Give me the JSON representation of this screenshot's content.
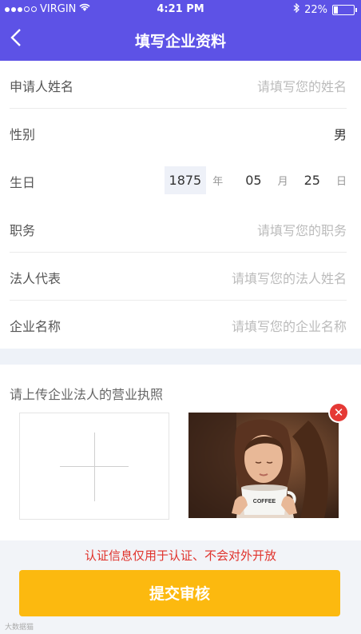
{
  "status_bar": {
    "carrier": "VIRGIN",
    "time": "4:21 PM",
    "battery": "22%",
    "battery_level": 0.22,
    "signal_icon": "signal-dots-icon",
    "wifi_icon": "wifi-icon",
    "bluetooth_icon": "bluetooth-icon"
  },
  "nav": {
    "back_icon": "back-arrow-icon",
    "title": "填写企业资料",
    "color": "#5d52e6"
  },
  "form": {
    "applicant": {
      "label": "申请人姓名",
      "placeholder": "请填写您的姓名"
    },
    "gender": {
      "label": "性别",
      "value": "男"
    },
    "birthday": {
      "label": "生日",
      "year": "1875",
      "year_unit": "年",
      "month": "05",
      "month_unit": "月",
      "day": "25",
      "day_unit": "日"
    },
    "position": {
      "label": "职务",
      "placeholder": "请填写您的职务"
    },
    "legal_rep": {
      "label": "法人代表",
      "placeholder": "请填写您的法人姓名"
    },
    "company": {
      "label": "企业名称",
      "placeholder": "请填写您的企业名称"
    }
  },
  "upload": {
    "label": "请上传企业法人的营业执照",
    "add_icon": "plus-icon",
    "photo_cup_text": "COFFEE",
    "remove_icon": "close-icon"
  },
  "notice": "认证信息仅用于认证、不会对外开放",
  "submit_label": "提交审核",
  "watermark": "大数据猫",
  "colors": {
    "accent": "#5d52e6",
    "button": "#fcb90f",
    "notice": "#e0322b",
    "remove": "#e53935"
  }
}
